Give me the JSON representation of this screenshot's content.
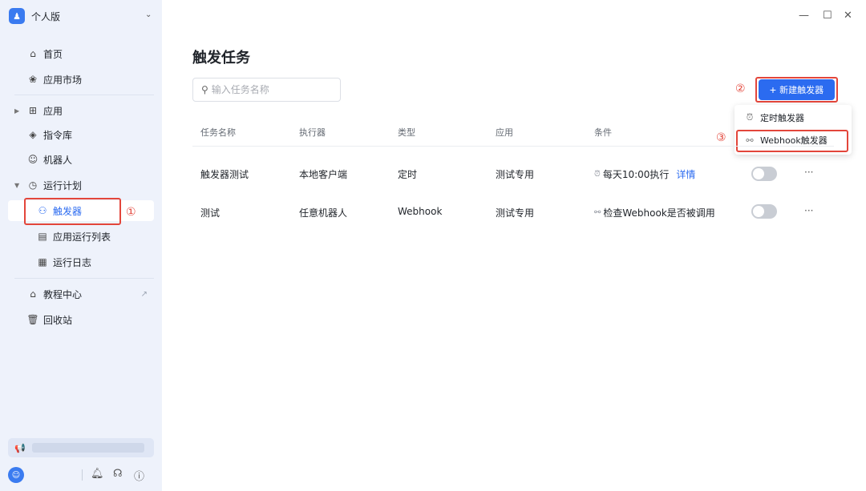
{
  "brand": {
    "name": "个人版"
  },
  "sidebar": {
    "items": [
      {
        "label": "首页"
      },
      {
        "label": "应用市场"
      },
      {
        "label": "应用"
      },
      {
        "label": "指令库"
      },
      {
        "label": "机器人"
      },
      {
        "label": "运行计划"
      },
      {
        "label": "触发器"
      },
      {
        "label": "应用运行列表"
      },
      {
        "label": "运行日志"
      },
      {
        "label": "教程中心"
      },
      {
        "label": "回收站"
      }
    ]
  },
  "annotations": {
    "n1": "①",
    "n2": "②",
    "n3": "③"
  },
  "main": {
    "title": "触发任务",
    "search_placeholder": "输入任务名称",
    "new_button": "新建触发器",
    "dropdown": [
      {
        "label": "定时触发器"
      },
      {
        "label": "Webhook触发器"
      }
    ],
    "columns": [
      "任务名称",
      "执行器",
      "类型",
      "应用",
      "条件"
    ],
    "rows": [
      {
        "name": "触发器测试",
        "executor": "本地客户端",
        "type": "定时",
        "app": "测试专用",
        "condition": "每天10:00执行",
        "detail": "详情",
        "enabled": false
      },
      {
        "name": "测试",
        "executor": "任意机器人",
        "type": "Webhook",
        "app": "测试专用",
        "condition": "检查Webhook是否被调用",
        "enabled": false
      }
    ]
  },
  "colors": {
    "accent": "#2b6bf0",
    "annotation": "#e3463b",
    "sidebar_bg": "#eef2fb"
  }
}
